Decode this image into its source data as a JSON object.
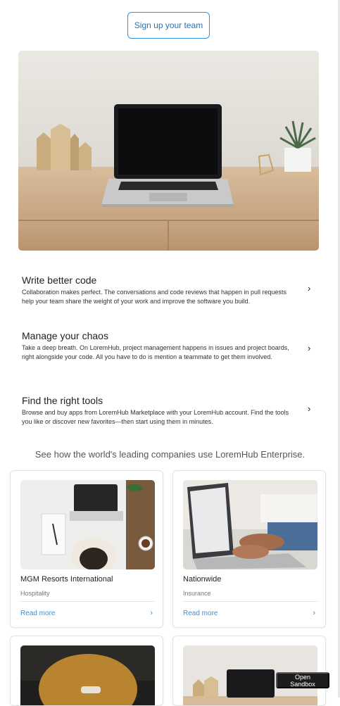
{
  "signup": {
    "label": "Sign up your team"
  },
  "hero": {
    "icon": "laptop-desk-photo"
  },
  "features": [
    {
      "title": "Write better code",
      "body": "Collaboration makes perfect. The conversations and code reviews that happen in pull requests help your team share the weight of your work and improve the software you build."
    },
    {
      "title": "Manage your chaos",
      "body": "Take a deep breath. On LoremHub, project management happens in issues and project boards, right alongside your code. All you have to do is mention a teammate to get them involved."
    },
    {
      "title": "Find the right tools",
      "body": "Browse and buy apps from LoremHub Marketplace with your LoremHub account. Find the tools you like or discover new favorites—then start using them in minutes."
    }
  ],
  "companies": {
    "heading": "See how the world's leading companies use LoremHub Enterprise.",
    "cards": [
      {
        "name": "MGM Resorts International",
        "industry": "Hospitality",
        "link": "Read more"
      },
      {
        "name": "Nationwide",
        "industry": "Insurance",
        "link": "Read more"
      }
    ]
  },
  "sandbox": {
    "label": "Open Sandbox"
  },
  "colors": {
    "accent": "#3b8fd6",
    "dark": "#1d1d1d"
  }
}
